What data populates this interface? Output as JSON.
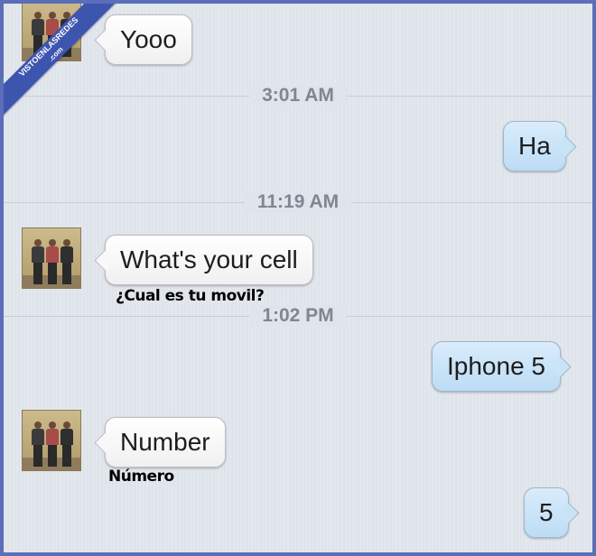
{
  "watermark": {
    "line1": "VISTOENLASREDES",
    "line2": ".com"
  },
  "timestamps": [
    "3:01 AM",
    "11:19 AM",
    "1:02 PM"
  ],
  "messages": [
    {
      "text": "Yooo",
      "side": "incoming"
    },
    {
      "text": "Ha",
      "side": "outgoing"
    },
    {
      "text": "What's your cell",
      "side": "incoming"
    },
    {
      "text": "Iphone 5",
      "side": "outgoing"
    },
    {
      "text": "Number",
      "side": "incoming"
    },
    {
      "text": "5",
      "side": "outgoing"
    }
  ],
  "captions": [
    "¿Cual es tu movil?",
    "Número"
  ],
  "colors": {
    "incoming_bubble": "#ffffff",
    "outgoing_bubble": "#c9e3f7",
    "background": "#dce0e8",
    "frame_border": "#5a6fb8",
    "timestamp_text": "#808692"
  }
}
